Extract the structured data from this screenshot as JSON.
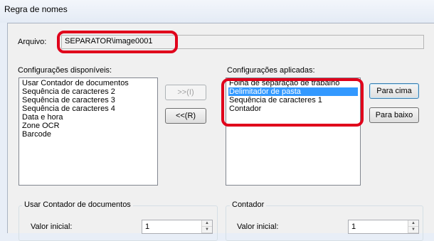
{
  "window": {
    "title": "Regra de nomes"
  },
  "arquivo": {
    "label": "Arquivo:",
    "value": "SEPARATOR\\image0001"
  },
  "available": {
    "label": "Configurações disponíveis:",
    "items": [
      "Usar Contador de documentos",
      "Sequência de caracteres 2",
      "Sequência de caracteres 3",
      "Sequência de caracteres 4",
      "Data e hora",
      "Zone OCR",
      "Barcode"
    ]
  },
  "applied": {
    "label": "Configurações aplicadas:",
    "items": [
      "Folha de separação de trabalho",
      "Delimitador de pasta",
      "Sequência de caracteres 1",
      "Contador"
    ],
    "selected_index": 1
  },
  "buttons": {
    "add": ">>(I)",
    "remove": "<<(R)",
    "up": "Para cima",
    "down": "Para baixo"
  },
  "group_left": {
    "title": "Usar Contador de documentos",
    "field_label": "Valor inicial:",
    "field_value": "1"
  },
  "group_right": {
    "title": "Contador",
    "field_label": "Valor inicial:",
    "field_value": "1"
  },
  "colors": {
    "highlight": "#e0001b",
    "selection": "#3399ff"
  }
}
